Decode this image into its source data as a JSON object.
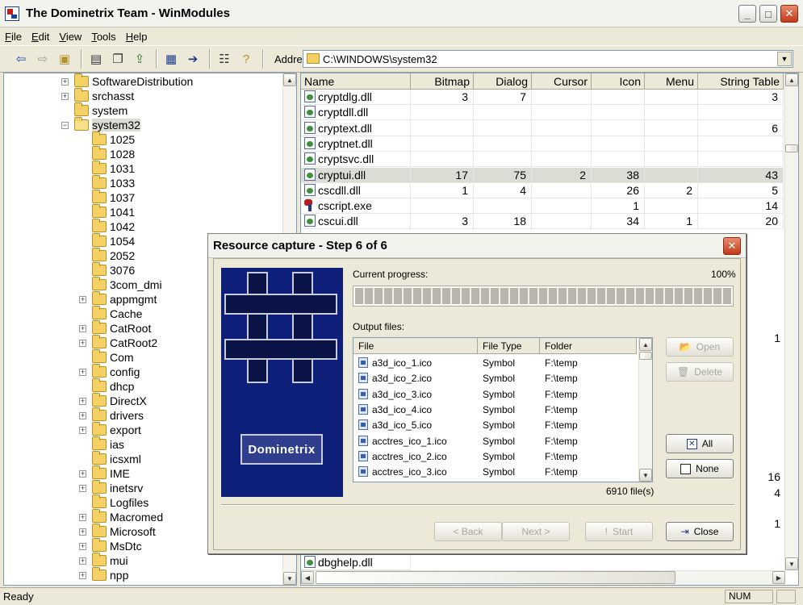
{
  "window": {
    "title": "The Dominetrix Team - WinModules",
    "controls": {
      "minimize": "_",
      "maximize": "□",
      "close": "✕"
    }
  },
  "menu": [
    {
      "label": "File",
      "key": "F",
      "rest": "ile"
    },
    {
      "label": "Edit",
      "key": "E",
      "rest": "dit"
    },
    {
      "label": "View",
      "key": "V",
      "rest": "iew"
    },
    {
      "label": "Tools",
      "key": "T",
      "rest": "ools"
    },
    {
      "label": "Help",
      "key": "H",
      "rest": "elp"
    }
  ],
  "toolbar": {
    "icons": [
      "back-arrow-icon",
      "forward-arrow-icon",
      "up-folder-icon",
      "properties-icon",
      "copy-icon",
      "export-icon",
      "grid-view-icon",
      "capture-icon",
      "list-view-icon",
      "help-icon"
    ],
    "address_label": "Address:",
    "address_value": "C:\\WINDOWS\\system32"
  },
  "tree": [
    {
      "label": "SoftwareDistribution",
      "plus": true,
      "level": 0
    },
    {
      "label": "srchasst",
      "plus": true,
      "level": 0
    },
    {
      "label": "system",
      "plus": false,
      "level": 0
    },
    {
      "label": "system32",
      "plus": true,
      "expanded": true,
      "level": 0,
      "selected": true
    },
    {
      "label": "1025",
      "plus": false,
      "level": 1
    },
    {
      "label": "1028",
      "plus": false,
      "level": 1
    },
    {
      "label": "1031",
      "plus": false,
      "level": 1
    },
    {
      "label": "1033",
      "plus": false,
      "level": 1
    },
    {
      "label": "1037",
      "plus": false,
      "level": 1
    },
    {
      "label": "1041",
      "plus": false,
      "level": 1
    },
    {
      "label": "1042",
      "plus": false,
      "level": 1
    },
    {
      "label": "1054",
      "plus": false,
      "level": 1
    },
    {
      "label": "2052",
      "plus": false,
      "level": 1
    },
    {
      "label": "3076",
      "plus": false,
      "level": 1
    },
    {
      "label": "3com_dmi",
      "plus": false,
      "level": 1
    },
    {
      "label": "appmgmt",
      "plus": true,
      "level": 1
    },
    {
      "label": "Cache",
      "plus": false,
      "level": 1
    },
    {
      "label": "CatRoot",
      "plus": true,
      "level": 1
    },
    {
      "label": "CatRoot2",
      "plus": true,
      "level": 1
    },
    {
      "label": "Com",
      "plus": false,
      "level": 1
    },
    {
      "label": "config",
      "plus": true,
      "level": 1
    },
    {
      "label": "dhcp",
      "plus": false,
      "level": 1
    },
    {
      "label": "DirectX",
      "plus": true,
      "level": 1
    },
    {
      "label": "drivers",
      "plus": true,
      "level": 1
    },
    {
      "label": "export",
      "plus": true,
      "level": 1
    },
    {
      "label": "ias",
      "plus": false,
      "level": 1
    },
    {
      "label": "icsxml",
      "plus": false,
      "level": 1
    },
    {
      "label": "IME",
      "plus": true,
      "level": 1
    },
    {
      "label": "inetsrv",
      "plus": true,
      "level": 1
    },
    {
      "label": "Logfiles",
      "plus": false,
      "level": 1
    },
    {
      "label": "Macromed",
      "plus": true,
      "level": 1
    },
    {
      "label": "Microsoft",
      "plus": true,
      "level": 1
    },
    {
      "label": "MsDtc",
      "plus": true,
      "level": 1
    },
    {
      "label": "mui",
      "plus": true,
      "level": 1
    },
    {
      "label": "npp",
      "plus": true,
      "level": 1
    }
  ],
  "list": {
    "columns": [
      "Name",
      "Bitmap",
      "Dialog",
      "Cursor",
      "Icon",
      "Menu",
      "String Table"
    ],
    "rows": [
      {
        "name": "cryptdlg.dll",
        "icon": "dll",
        "cells": [
          "3",
          "7",
          "",
          "",
          "",
          "3"
        ]
      },
      {
        "name": "cryptdll.dll",
        "icon": "dll",
        "cells": [
          "",
          "",
          "",
          "",
          "",
          ""
        ]
      },
      {
        "name": "cryptext.dll",
        "icon": "dll",
        "cells": [
          "",
          "",
          "",
          "",
          "",
          "6"
        ]
      },
      {
        "name": "cryptnet.dll",
        "icon": "dll",
        "cells": [
          "",
          "",
          "",
          "",
          "",
          ""
        ]
      },
      {
        "name": "cryptsvc.dll",
        "icon": "dll",
        "cells": [
          "",
          "",
          "",
          "",
          "",
          ""
        ]
      },
      {
        "name": "cryptui.dll",
        "icon": "dll",
        "cells": [
          "17",
          "75",
          "2",
          "38",
          "",
          "43"
        ],
        "selected": true
      },
      {
        "name": "cscdll.dll",
        "icon": "dll",
        "cells": [
          "1",
          "4",
          "",
          "26",
          "2",
          "5"
        ]
      },
      {
        "name": "cscript.exe",
        "icon": "exe",
        "cells": [
          "",
          "",
          "",
          "1",
          "",
          "14"
        ]
      },
      {
        "name": "cscui.dll",
        "icon": "dll",
        "cells": [
          "3",
          "18",
          "",
          "34",
          "1",
          "20"
        ]
      }
    ],
    "hidden_rows": [
      {
        "string_table": "1"
      },
      {
        "string_table": "16"
      },
      {
        "string_table": "4"
      },
      {
        "string_table": "1"
      }
    ],
    "bottom_row": {
      "name": "dbghelp.dll",
      "icon": "dll"
    }
  },
  "status": {
    "text": "Ready",
    "num": "NUM"
  },
  "dialog": {
    "title": "Resource capture - Step 6 of 6",
    "logo_text": "Dominetrix",
    "current_progress_label": "Current progress:",
    "progress_percent_label": "100%",
    "progress_value": 1.0,
    "output_files_label": "Output files:",
    "file_columns": [
      "File",
      "File Type",
      "Folder"
    ],
    "files": [
      {
        "file": "a3d_ico_1.ico",
        "type": "Symbol",
        "folder": "F:\\temp"
      },
      {
        "file": "a3d_ico_2.ico",
        "type": "Symbol",
        "folder": "F:\\temp"
      },
      {
        "file": "a3d_ico_3.ico",
        "type": "Symbol",
        "folder": "F:\\temp"
      },
      {
        "file": "a3d_ico_4.ico",
        "type": "Symbol",
        "folder": "F:\\temp"
      },
      {
        "file": "a3d_ico_5.ico",
        "type": "Symbol",
        "folder": "F:\\temp"
      },
      {
        "file": "acctres_ico_1.ico",
        "type": "Symbol",
        "folder": "F:\\temp"
      },
      {
        "file": "acctres_ico_2.ico",
        "type": "Symbol",
        "folder": "F:\\temp"
      },
      {
        "file": "acctres_ico_3.ico",
        "type": "Symbol",
        "folder": "F:\\temp"
      }
    ],
    "file_count": "6910 file(s)",
    "buttons": {
      "open": "Open",
      "delete": "Delete",
      "all": "All",
      "none": "None",
      "back": "< Back",
      "next": "Next >",
      "start": "Start",
      "close": "Close"
    }
  }
}
